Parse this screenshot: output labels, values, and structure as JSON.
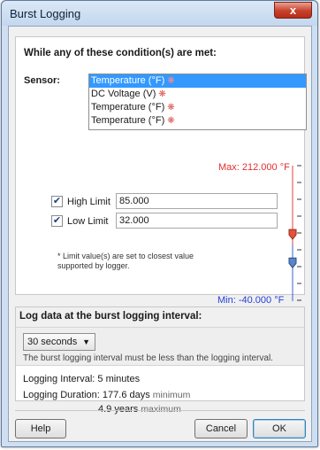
{
  "window": {
    "title": "Burst Logging",
    "close_glyph": "x"
  },
  "conditions": {
    "heading": "While any of these condition(s) are met:",
    "sensor_label": "Sensor:",
    "sensors": [
      {
        "label": "Temperature (°F)",
        "icon": "alarm-bell-icon",
        "selected": true
      },
      {
        "label": "DC Voltage (V)",
        "icon": "alarm-bell-icon",
        "selected": false
      },
      {
        "label": "Temperature (°F)",
        "icon": "alarm-bell-icon",
        "selected": false
      },
      {
        "label": "Temperature (°F)",
        "icon": "alarm-bell-icon",
        "selected": false
      }
    ],
    "max_label": "Max: 212.000 °F",
    "min_label": "Min: -40.000 °F",
    "high_limit": {
      "label": "High Limit",
      "value": "85.000",
      "checked": true
    },
    "low_limit": {
      "label": "Low Limit",
      "value": "32.000",
      "checked": true
    },
    "note": "*  Limit value(s) are set to closest value supported by logger.",
    "slider": {
      "min": -40,
      "max": 212,
      "high": 85,
      "low": 32
    }
  },
  "logging": {
    "heading": "Log data at the burst logging interval:",
    "interval_selected": "30 seconds",
    "interval_note": "The burst logging interval must be less than the logging interval.",
    "logging_interval_label": "Logging Interval:",
    "logging_interval_value": "5 minutes",
    "logging_duration_label": "Logging Duration:",
    "duration_min_value": "177.6 days",
    "duration_min_qualifier": "minimum",
    "duration_max_value": "4.9 years",
    "duration_max_qualifier": "maximum"
  },
  "footer": {
    "help": "Help",
    "cancel": "Cancel",
    "ok": "OK"
  },
  "colors": {
    "max": "#e23030",
    "min": "#2640d8",
    "selection": "#3399ff",
    "high_marker": "#e0533b",
    "low_marker": "#5b86c8"
  }
}
